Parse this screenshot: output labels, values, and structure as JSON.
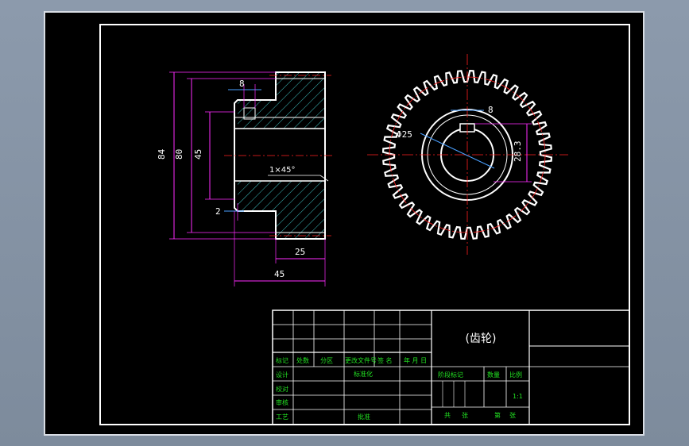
{
  "drawing": {
    "title": "(齿轮)",
    "dimensions": {
      "d8_top": "8",
      "d84": "84",
      "d80": "80",
      "d45_bore": "45",
      "d2": "2",
      "chamfer": "1×45°",
      "d25_width": "25",
      "d45_length": "45",
      "d8_key": "8",
      "phi25": "Φ25",
      "d28_3": "28.3"
    },
    "title_block": {
      "row_labels": [
        "标记",
        "处数",
        "分区",
        "更改文件号",
        "签 名",
        "年 月 日"
      ],
      "design": "设计",
      "standardize": "标准化",
      "check": "校对",
      "review": "审核",
      "process": "工艺",
      "approve": "批准",
      "stage_mark": "阶段标记",
      "quantity": "数量",
      "scale": "比例",
      "scale_value": "1:1",
      "total": "共",
      "sheets": "张",
      "sheet_no": "第",
      "sheets2": "张"
    }
  },
  "colors": {
    "background": "#000000",
    "outline": "#ffffff",
    "centerline": "#ff2020",
    "dimension": "#ff2cff",
    "dim_small": "#4aa0ff",
    "hatch": "#3fbfbf",
    "titleblock_text": "#22e022"
  }
}
